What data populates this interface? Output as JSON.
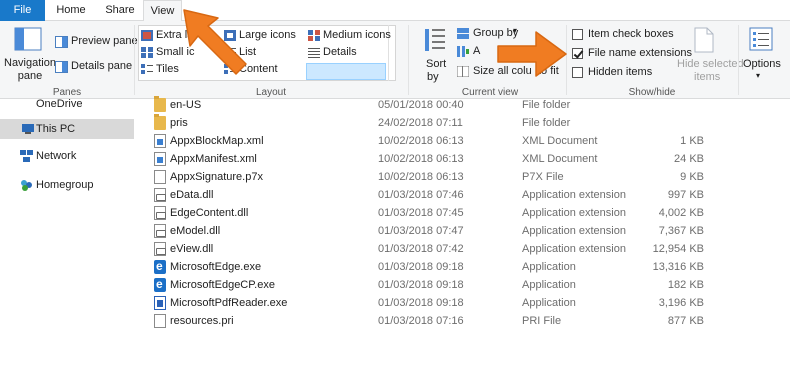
{
  "tabs": {
    "file": "File",
    "home": "Home",
    "share": "Share",
    "view": "View"
  },
  "ribbon": {
    "panes": {
      "navigation_pane": "Navigation pane",
      "preview_pane": "Preview pane",
      "details_pane": "Details pane",
      "group_label": "Panes"
    },
    "layout": {
      "extra_large_icons": "Extra la",
      "large_icons": "Large icons",
      "medium_icons": "Medium icons",
      "small_icons": "Small ic",
      "list": "List",
      "details": "Details",
      "tiles": "Tiles",
      "content": "Content",
      "group_label": "Layout"
    },
    "current_view": {
      "sort_by": "Sort",
      "sort_by_line2": "by",
      "group_by": "Group by",
      "add_columns": "A",
      "size_all_columns": "Size all colu",
      "size_all_columns_tail": "to fit",
      "group_label": "Current view"
    },
    "show_hide": {
      "item_check_boxes": "Item check boxes",
      "item_check_boxes_checked": false,
      "file_name_extensions": "File name extensions",
      "file_name_extensions_checked": true,
      "hidden_items": "Hidden items",
      "hidden_items_checked": false,
      "hide_selected_items": "Hide selected",
      "hide_selected_items_line2": "items",
      "group_label": "Show/hide"
    },
    "options": {
      "options": "Options"
    }
  },
  "nav": {
    "items": [
      {
        "label": "OneDrive"
      },
      {
        "label": "This PC"
      },
      {
        "label": "Network"
      },
      {
        "label": "Homegroup"
      }
    ]
  },
  "files": [
    {
      "name": "en-US",
      "date": "05/01/2018 00:40",
      "type": "File folder",
      "size": "",
      "icon": "folder"
    },
    {
      "name": "pris",
      "date": "24/02/2018 07:11",
      "type": "File folder",
      "size": "",
      "icon": "folder"
    },
    {
      "name": "AppxBlockMap.xml",
      "date": "10/02/2018 06:13",
      "type": "XML Document",
      "size": "1 KB",
      "icon": "xml"
    },
    {
      "name": "AppxManifest.xml",
      "date": "10/02/2018 06:13",
      "type": "XML Document",
      "size": "24 KB",
      "icon": "xml"
    },
    {
      "name": "AppxSignature.p7x",
      "date": "10/02/2018 06:13",
      "type": "P7X File",
      "size": "9 KB",
      "icon": "doc"
    },
    {
      "name": "eData.dll",
      "date": "01/03/2018 07:46",
      "type": "Application extension",
      "size": "997 KB",
      "icon": "dll"
    },
    {
      "name": "EdgeContent.dll",
      "date": "01/03/2018 07:45",
      "type": "Application extension",
      "size": "4,002 KB",
      "icon": "dll"
    },
    {
      "name": "eModel.dll",
      "date": "01/03/2018 07:47",
      "type": "Application extension",
      "size": "7,367 KB",
      "icon": "dll"
    },
    {
      "name": "eView.dll",
      "date": "01/03/2018 07:42",
      "type": "Application extension",
      "size": "12,954 KB",
      "icon": "dll"
    },
    {
      "name": "MicrosoftEdge.exe",
      "date": "01/03/2018 09:18",
      "type": "Application",
      "size": "13,316 KB",
      "icon": "edge"
    },
    {
      "name": "MicrosoftEdgeCP.exe",
      "date": "01/03/2018 09:18",
      "type": "Application",
      "size": "182 KB",
      "icon": "edge"
    },
    {
      "name": "MicrosoftPdfReader.exe",
      "date": "01/03/2018 09:18",
      "type": "Application",
      "size": "3,196 KB",
      "icon": "app"
    },
    {
      "name": "resources.pri",
      "date": "01/03/2018 07:16",
      "type": "PRI File",
      "size": "877 KB",
      "icon": "doc"
    }
  ],
  "colors": {
    "accent": "#1979ca",
    "arrow": "#f07c22",
    "selection": "#cce8ff"
  }
}
